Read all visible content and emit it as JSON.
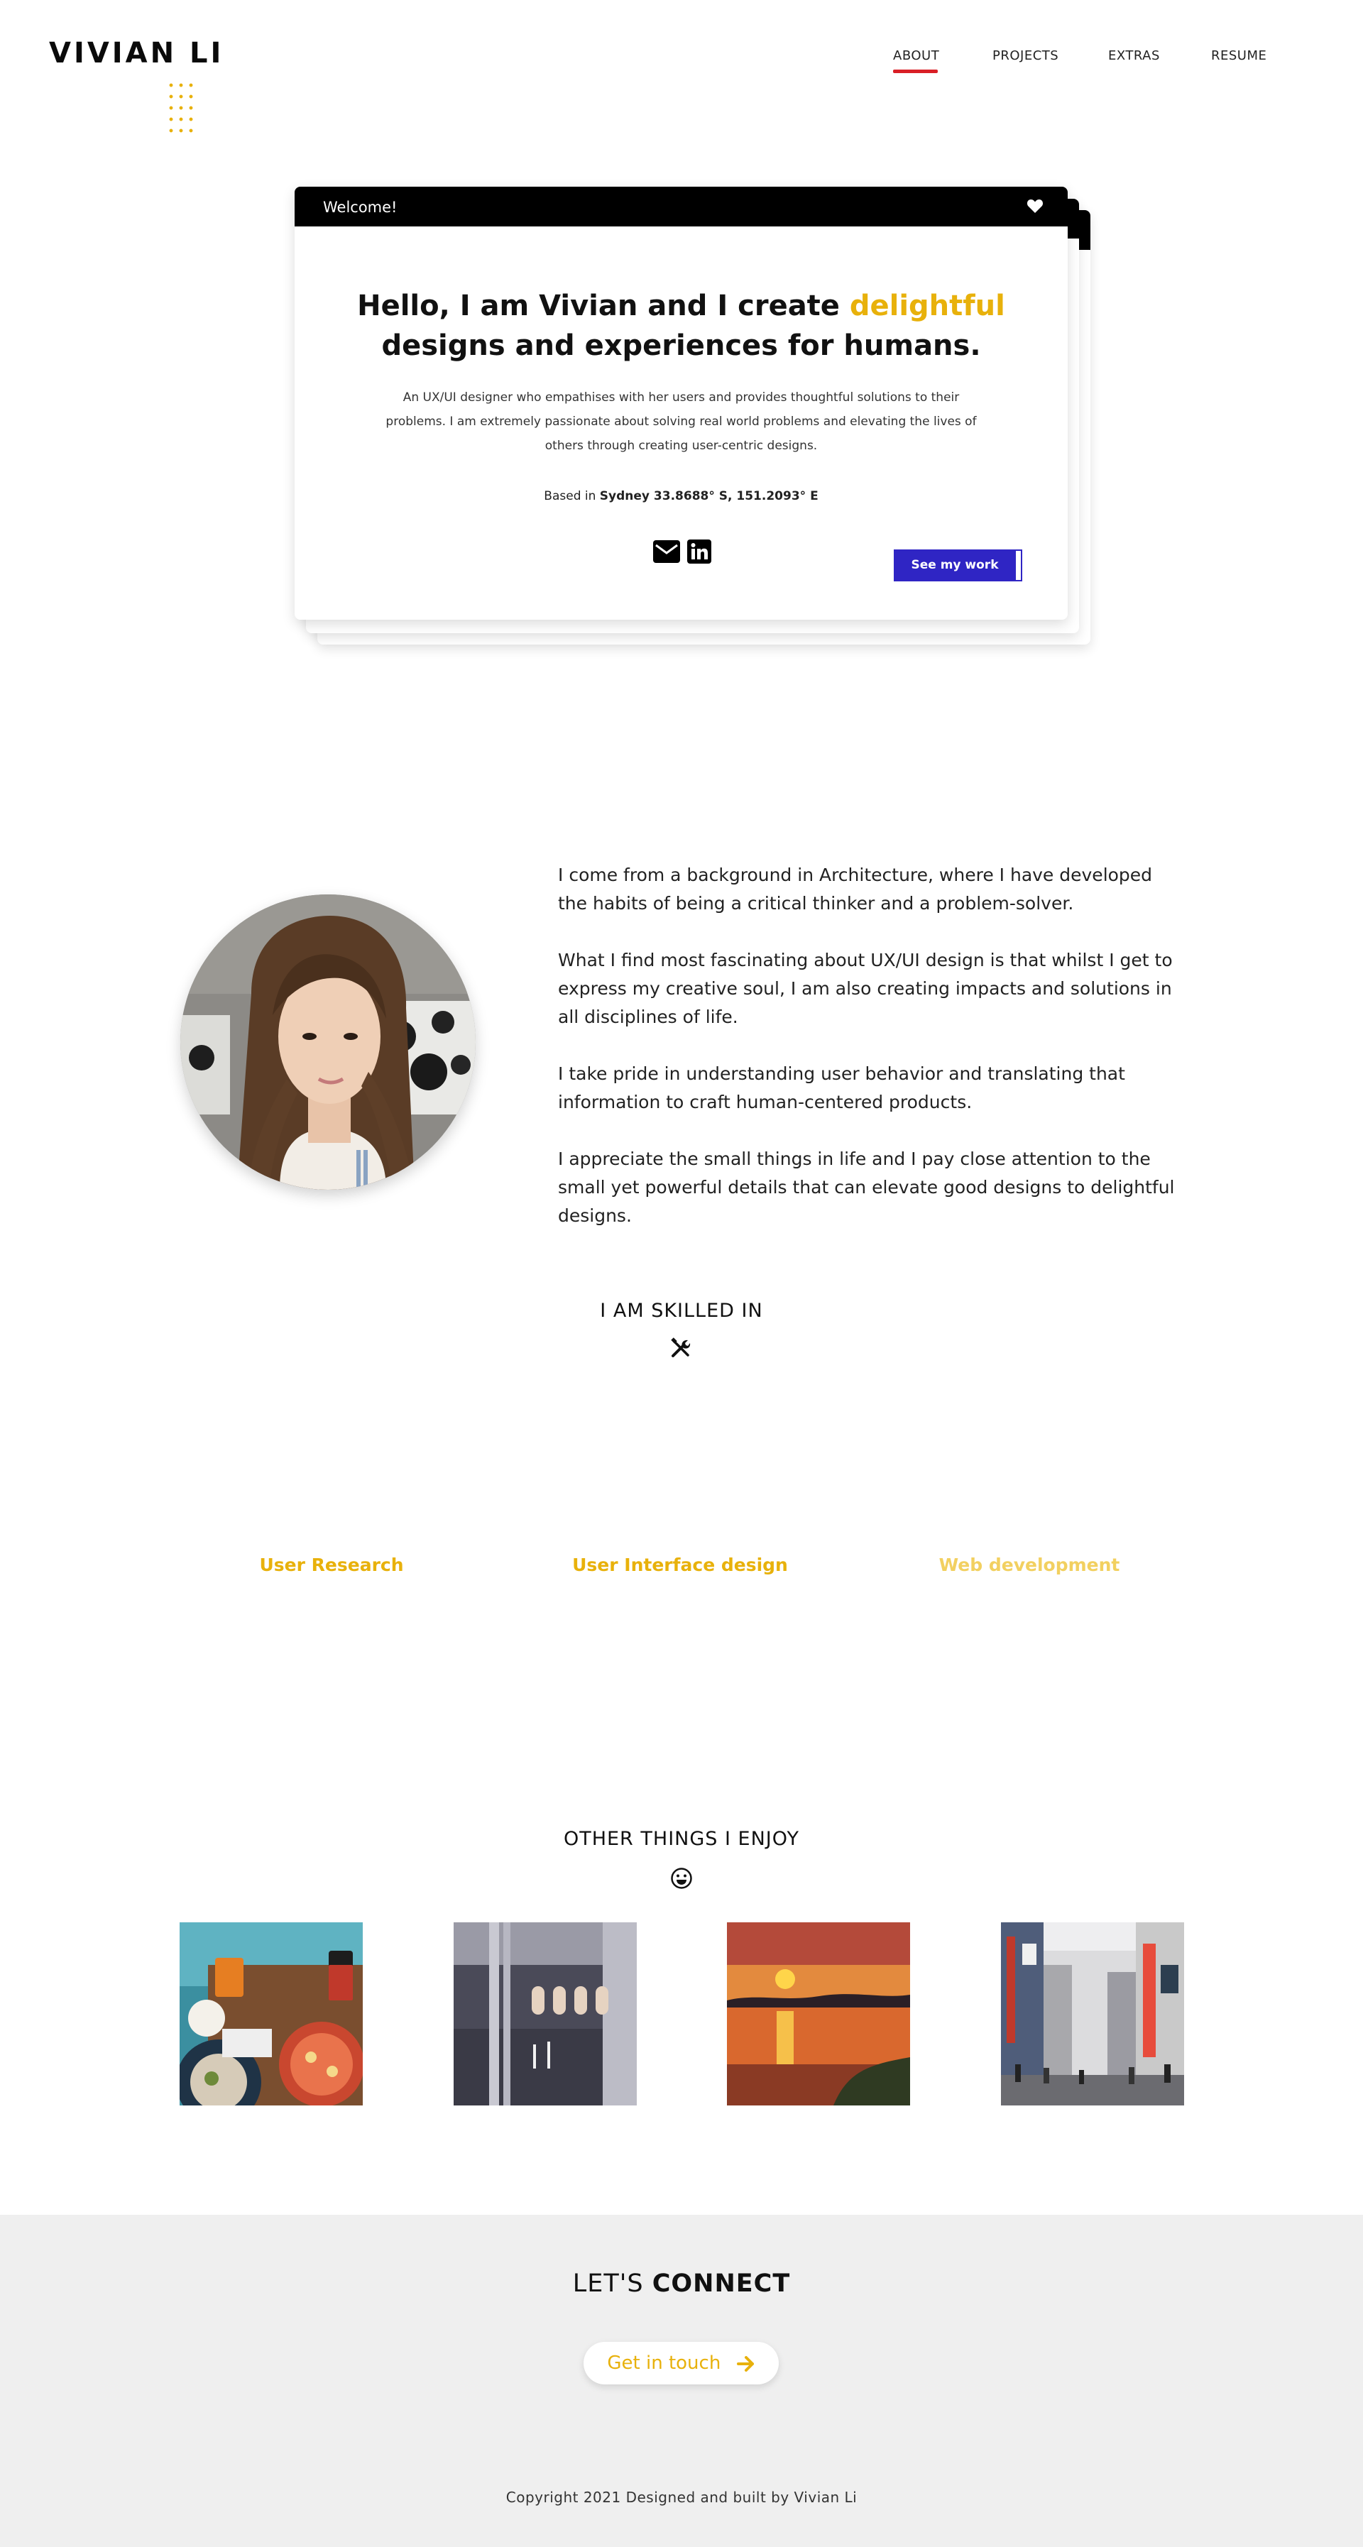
{
  "header": {
    "logo": "VIVIAN LI",
    "nav": [
      "ABOUT",
      "PROJECTS",
      "EXTRAS",
      "RESUME"
    ],
    "active_nav": "ABOUT"
  },
  "hero": {
    "bar_title": "Welcome!",
    "bar_icon": "heart-icon",
    "title_part1": "Hello, I am Vivian and I create ",
    "title_highlight": "delightful",
    "title_part2": "designs and experiences for humans.",
    "description": "An UX/UI designer who empathises with her users and provides thoughtful solutions to their problems. I am extremely passionate about solving real world problems and elevating the lives of others through creating user-centric designs.",
    "location_prefix": "Based in ",
    "location": "Sydney 33.8688° S, 151.2093° E",
    "icons": [
      "mail-icon",
      "linkedin-icon"
    ],
    "cta": "See my work"
  },
  "about": {
    "paragraphs": [
      "I come from a background in Architecture, where I have developed the habits of being a critical thinker and a problem-solver.",
      "What I find most fascinating about UX/UI design is that whilst I get to express my creative soul, I am also creating impacts and solutions in all disciplines of life.",
      "I take pride in understanding user behavior and translating that information to craft human-centered products.",
      "I appreciate the small things in life and I pay close attention to the small yet powerful details that can elevate good designs to delightful designs."
    ]
  },
  "skills": {
    "title": "I AM SKILLED IN",
    "icon": "tools-icon",
    "items": [
      "User Research",
      "User Interface design",
      "Web development"
    ]
  },
  "enjoy": {
    "title": "OTHER THINGS I ENJOY",
    "icon": "smile-icon",
    "photos": [
      "food-photo",
      "architecture-photo",
      "sunset-painting-photo",
      "city-street-photo"
    ]
  },
  "footer": {
    "connect_prefix": "LET'S ",
    "connect_bold": "CONNECT",
    "button": "Get in touch",
    "copyright": "Copyright 2021 Designed and built by Vivian Li"
  },
  "colors": {
    "accent": "#e8b10b",
    "nav_underline": "#d91f26",
    "cta": "#2f25c4",
    "footer_bg": "#efefef"
  }
}
